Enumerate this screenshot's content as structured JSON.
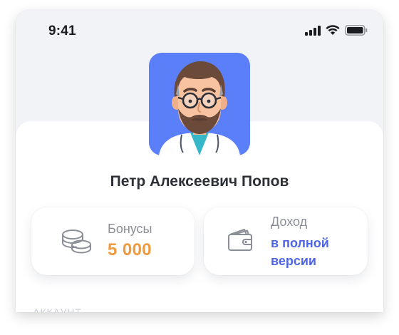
{
  "status_bar": {
    "time": "9:41",
    "icons": [
      "cellular-signal-icon",
      "wifi-icon",
      "battery-icon"
    ]
  },
  "profile": {
    "name": "Петр Алексеевич Попов",
    "avatar_background": "#5a7ff9"
  },
  "stats": {
    "bonus": {
      "label": "Бонусы",
      "value": "5 000",
      "icon": "coins-icon",
      "value_color": "#f09a3e"
    },
    "income": {
      "label": "Доход",
      "value": "в полной версии",
      "icon": "wallet-icon",
      "value_color": "#4e66e6"
    }
  },
  "section": {
    "label": "АККАУНТ"
  }
}
